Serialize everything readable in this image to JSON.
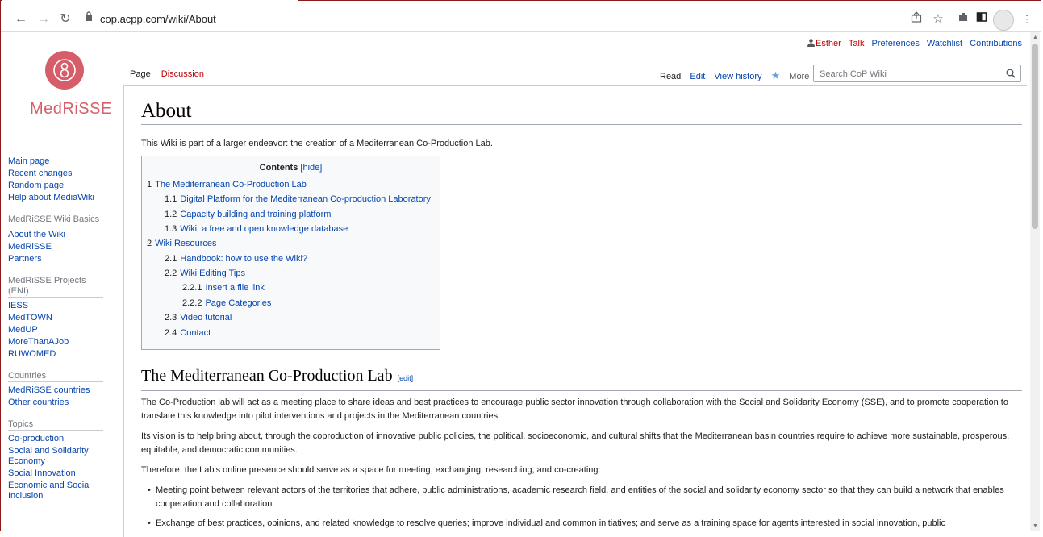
{
  "browser": {
    "url": "cop.acpp.com/wiki/About"
  },
  "personal": {
    "user": "Esther",
    "talk": "Talk",
    "preferences": "Preferences",
    "watchlist": "Watchlist",
    "contributions": "Contributions"
  },
  "logo": {
    "text": "MedRiSSE"
  },
  "sidebar": {
    "nav": [
      "Main page",
      "Recent changes",
      "Random page",
      "Help about MediaWiki"
    ],
    "basics_heading": "MedRiSSE Wiki Basics",
    "basics": [
      "About the Wiki",
      "MedRiSSE",
      "Partners"
    ],
    "projects_heading": "MedRiSSE Projects (ENI)",
    "projects": [
      "IESS",
      "MedTOWN",
      "MedUP",
      "MoreThanAJob",
      "RUWOMED"
    ],
    "countries_heading": "Countries",
    "countries": [
      "MedRiSSE countries",
      "Other countries"
    ],
    "topics_heading": "Topics",
    "topics": [
      "Co-production",
      "Social and Solidarity Economy",
      "Social Innovation",
      "Economic and Social Inclusion"
    ]
  },
  "tabs": {
    "page": "Page",
    "discussion": "Discussion",
    "read": "Read",
    "edit": "Edit",
    "history": "View history",
    "more": "More"
  },
  "search": {
    "placeholder": "Search CoP Wiki"
  },
  "article": {
    "title": "About",
    "intro": "This Wiki is part of a larger endeavor: the creation of a Mediterranean Co-Production Lab.",
    "toc": {
      "title": "Contents",
      "hide": "[hide]",
      "items": [
        {
          "num": "1",
          "text": "The Mediterranean Co-Production Lab"
        },
        {
          "num": "1.1",
          "text": "Digital Platform for the Mediterranean Co-production Laboratory"
        },
        {
          "num": "1.2",
          "text": "Capacity building and training platform"
        },
        {
          "num": "1.3",
          "text": "Wiki: a free and open knowledge database"
        },
        {
          "num": "2",
          "text": "Wiki Resources"
        },
        {
          "num": "2.1",
          "text": "Handbook: how to use the Wiki?"
        },
        {
          "num": "2.2",
          "text": "Wiki Editing Tips"
        },
        {
          "num": "2.2.1",
          "text": "Insert a file link"
        },
        {
          "num": "2.2.2",
          "text": "Page Categories"
        },
        {
          "num": "2.3",
          "text": "Video tutorial"
        },
        {
          "num": "2.4",
          "text": "Contact"
        }
      ]
    },
    "section_title": "The Mediterranean Co-Production Lab",
    "section_edit": "[edit]",
    "paragraphs": [
      "The Co-Production lab will act as a meeting place to share ideas and best practices to encourage public sector innovation through collaboration with the Social and Solidarity Economy (SSE), and to promote cooperation to translate this knowledge into pilot interventions and projects in the Mediterranean countries.",
      "Its vision is to help bring about, through the coproduction of innovative public policies, the political, socioeconomic, and cultural shifts that the Mediterranean basin countries require to achieve more sustainable, prosperous, equitable, and democratic communities.",
      "Therefore, the Lab's online presence should serve as a space for meeting, exchanging, researching, and co-creating:"
    ],
    "bullets": [
      "Meeting point between relevant actors of the territories that adhere, public administrations, academic research field, and entities of the social and solidarity economy sector so that they can build a network that enables cooperation and collaboration.",
      "Exchange of best practices, opinions, and related knowledge to resolve queries; improve individual and common initiatives; and serve as a training space for agents interested in social innovation, public"
    ]
  },
  "colors": {
    "link": "#0645ad",
    "brand": "#d65e6a",
    "frame": "#8b1a1a"
  }
}
